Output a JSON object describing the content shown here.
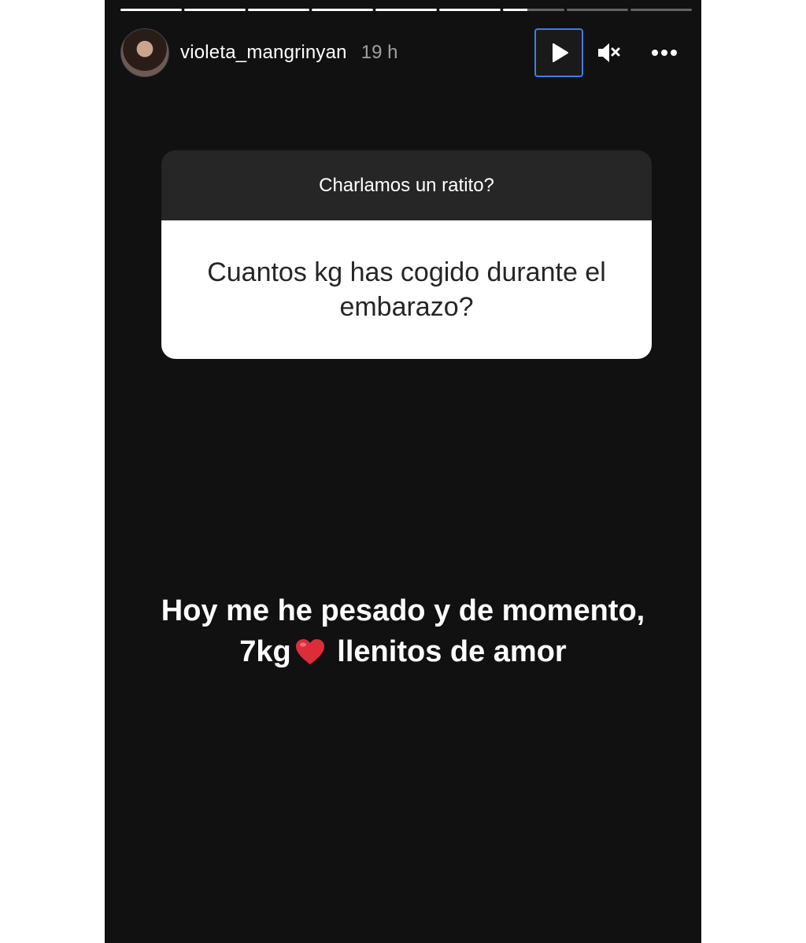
{
  "story": {
    "segments": 9,
    "active_segment": 7,
    "active_progress": 0.4
  },
  "header": {
    "username": "violeta_mangrinyan",
    "time": "19 h",
    "avatar_icon": "profile-avatar",
    "play_icon": "play-icon",
    "mute_icon": "muted-speaker-icon",
    "more_icon": "more-horizontal-icon"
  },
  "question": {
    "title": "Charlamos un ratito?",
    "text": "Cuantos kg has cogido durante el embarazo?"
  },
  "answer": {
    "line1": "Hoy me he pesado y de momento,",
    "line2_before": "7kg",
    "line2_after": " llenitos de amor",
    "emoji": "red-heart"
  },
  "colors": {
    "background": "#111111",
    "focus_ring": "#3d7ee6",
    "heart": "#e02b3b"
  }
}
